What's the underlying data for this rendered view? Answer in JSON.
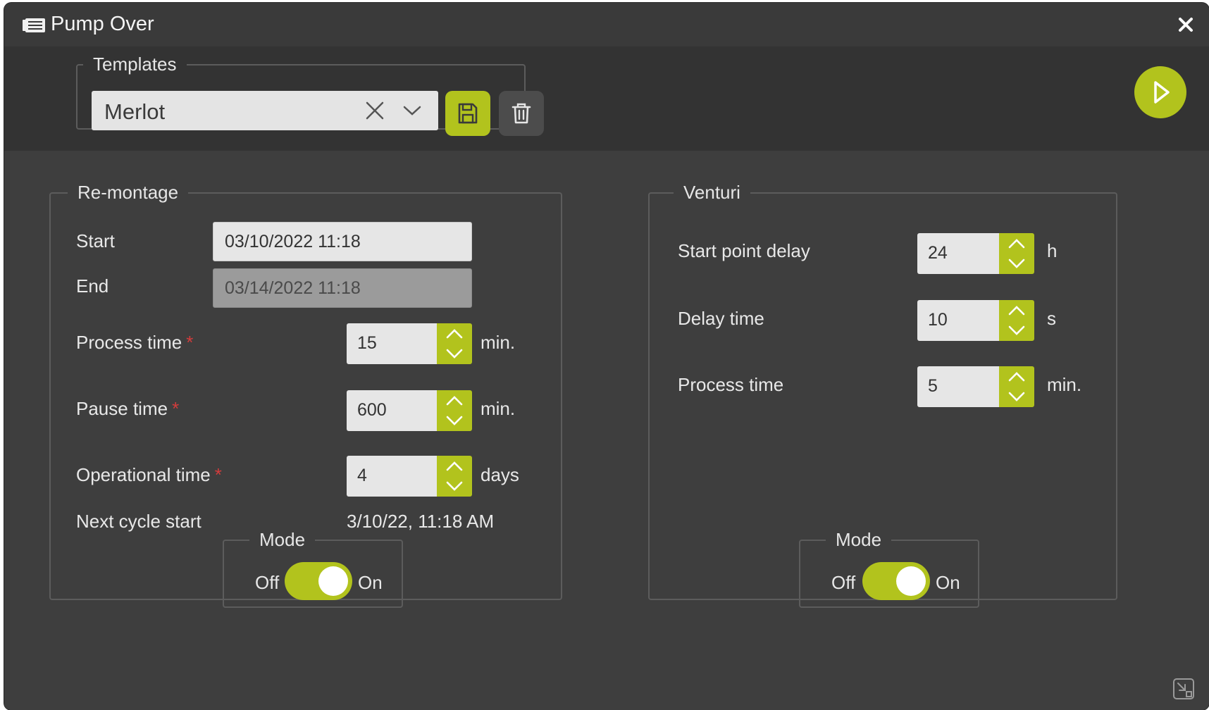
{
  "window": {
    "title": "Pump Over",
    "title_icon": "folder-stack-icon",
    "close_icon": "close-icon"
  },
  "templates": {
    "legend": "Templates",
    "selected": "Merlot",
    "clear_icon": "clear-x-icon",
    "dropdown_icon": "chevron-down-icon",
    "save_icon": "floppy-disk-icon",
    "delete_icon": "trash-icon"
  },
  "play": {
    "icon": "play-icon"
  },
  "remontage": {
    "legend": "Re-montage",
    "start_label": "Start",
    "start_value": "03/10/2022 11:18",
    "end_label": "End",
    "end_value": "03/14/2022 11:18",
    "process_time": {
      "label": "Process time",
      "required": "*",
      "value": "15",
      "unit": "min."
    },
    "pause_time": {
      "label": "Pause time",
      "required": "*",
      "value": "600",
      "unit": "min."
    },
    "operational_time": {
      "label": "Operational time",
      "required": "*",
      "value": "4",
      "unit": "days"
    },
    "next_cycle": {
      "label": "Next cycle start",
      "value": "3/10/22, 11:18 AM"
    },
    "mode": {
      "legend": "Mode",
      "off": "Off",
      "on": "On",
      "state": "on"
    }
  },
  "venturi": {
    "legend": "Venturi",
    "start_point_delay": {
      "label": "Start point delay",
      "value": "24",
      "unit": "h"
    },
    "delay_time": {
      "label": "Delay time",
      "value": "10",
      "unit": "s"
    },
    "process_time": {
      "label": "Process time",
      "value": "5",
      "unit": "min."
    },
    "mode": {
      "legend": "Mode",
      "off": "Off",
      "on": "On",
      "state": "on"
    }
  },
  "colors": {
    "accent": "#b2c31d",
    "window_bg": "#3e3e3e",
    "toolbar_bg": "#333333",
    "required": "#d33c3c"
  },
  "footer": {
    "resize_icon": "resize-icon"
  }
}
